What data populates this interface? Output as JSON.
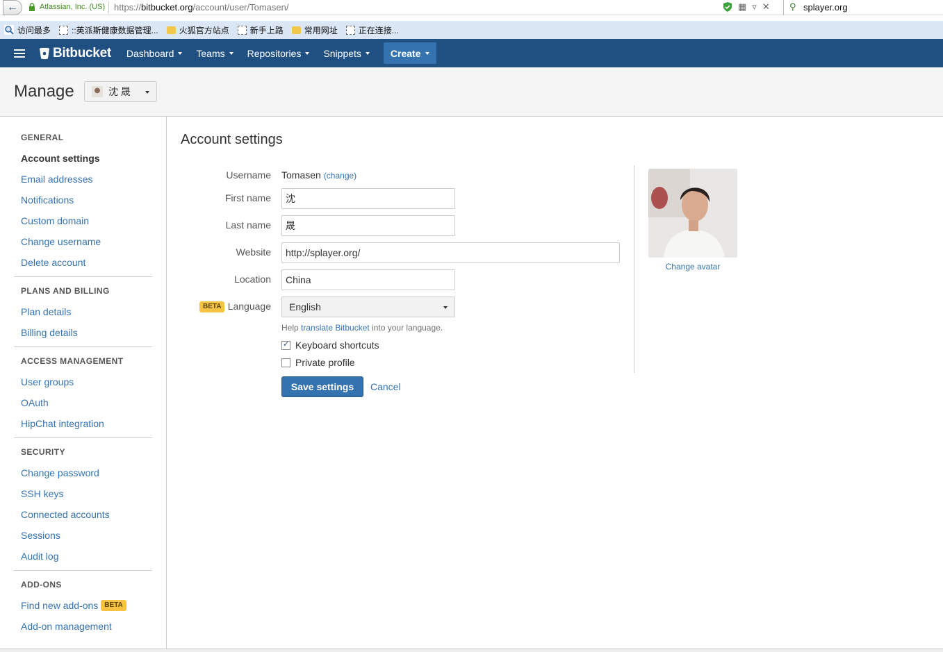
{
  "browser": {
    "site_identity": "Atlassian, Inc. (US)",
    "url_prefix": "https://",
    "url_domain": "bitbucket.org",
    "url_path": "/account/user/Tomasen/",
    "search_value": "splayer.org",
    "bookmarks": [
      "访问最多",
      "::英派斯健康数据管理...",
      "火狐官方站点",
      "新手上路",
      "常用网址",
      "正在连接..."
    ]
  },
  "header": {
    "logo": "Bitbucket",
    "nav": [
      "Dashboard",
      "Teams",
      "Repositories",
      "Snippets"
    ],
    "create": "Create",
    "brand_color": "#205081"
  },
  "pagehead": {
    "title": "Manage",
    "account": "沈 晟"
  },
  "sidebar": {
    "sections": [
      {
        "heading": "GENERAL",
        "items": [
          "Account settings",
          "Email addresses",
          "Notifications",
          "Custom domain",
          "Change username",
          "Delete account"
        ]
      },
      {
        "heading": "PLANS AND BILLING",
        "items": [
          "Plan details",
          "Billing details"
        ]
      },
      {
        "heading": "ACCESS MANAGEMENT",
        "items": [
          "User groups",
          "OAuth",
          "HipChat integration"
        ]
      },
      {
        "heading": "SECURITY",
        "items": [
          "Change password",
          "SSH keys",
          "Connected accounts",
          "Sessions",
          "Audit log"
        ]
      },
      {
        "heading": "ADD-ONS",
        "items": [
          "Find new add-ons",
          "Add-on management"
        ]
      }
    ],
    "active": "Account settings",
    "beta": "BETA"
  },
  "form": {
    "title": "Account settings",
    "username_label": "Username",
    "username": "Tomasen",
    "change_link": "(change)",
    "first_name_label": "First name",
    "first_name": "沈",
    "last_name_label": "Last name",
    "last_name": "晟",
    "website_label": "Website",
    "website": "http://splayer.org/",
    "location_label": "Location",
    "location": "China",
    "beta": "BETA",
    "language_label": "Language",
    "language": "English",
    "help_prefix": "Help ",
    "help_link": "translate Bitbucket",
    "help_suffix": " into your language.",
    "keyboard_shortcuts": "Keyboard shortcuts",
    "keyboard_shortcuts_checked": true,
    "private_profile": "Private profile",
    "private_profile_checked": false,
    "save": "Save settings",
    "cancel": "Cancel",
    "change_avatar": "Change avatar"
  }
}
